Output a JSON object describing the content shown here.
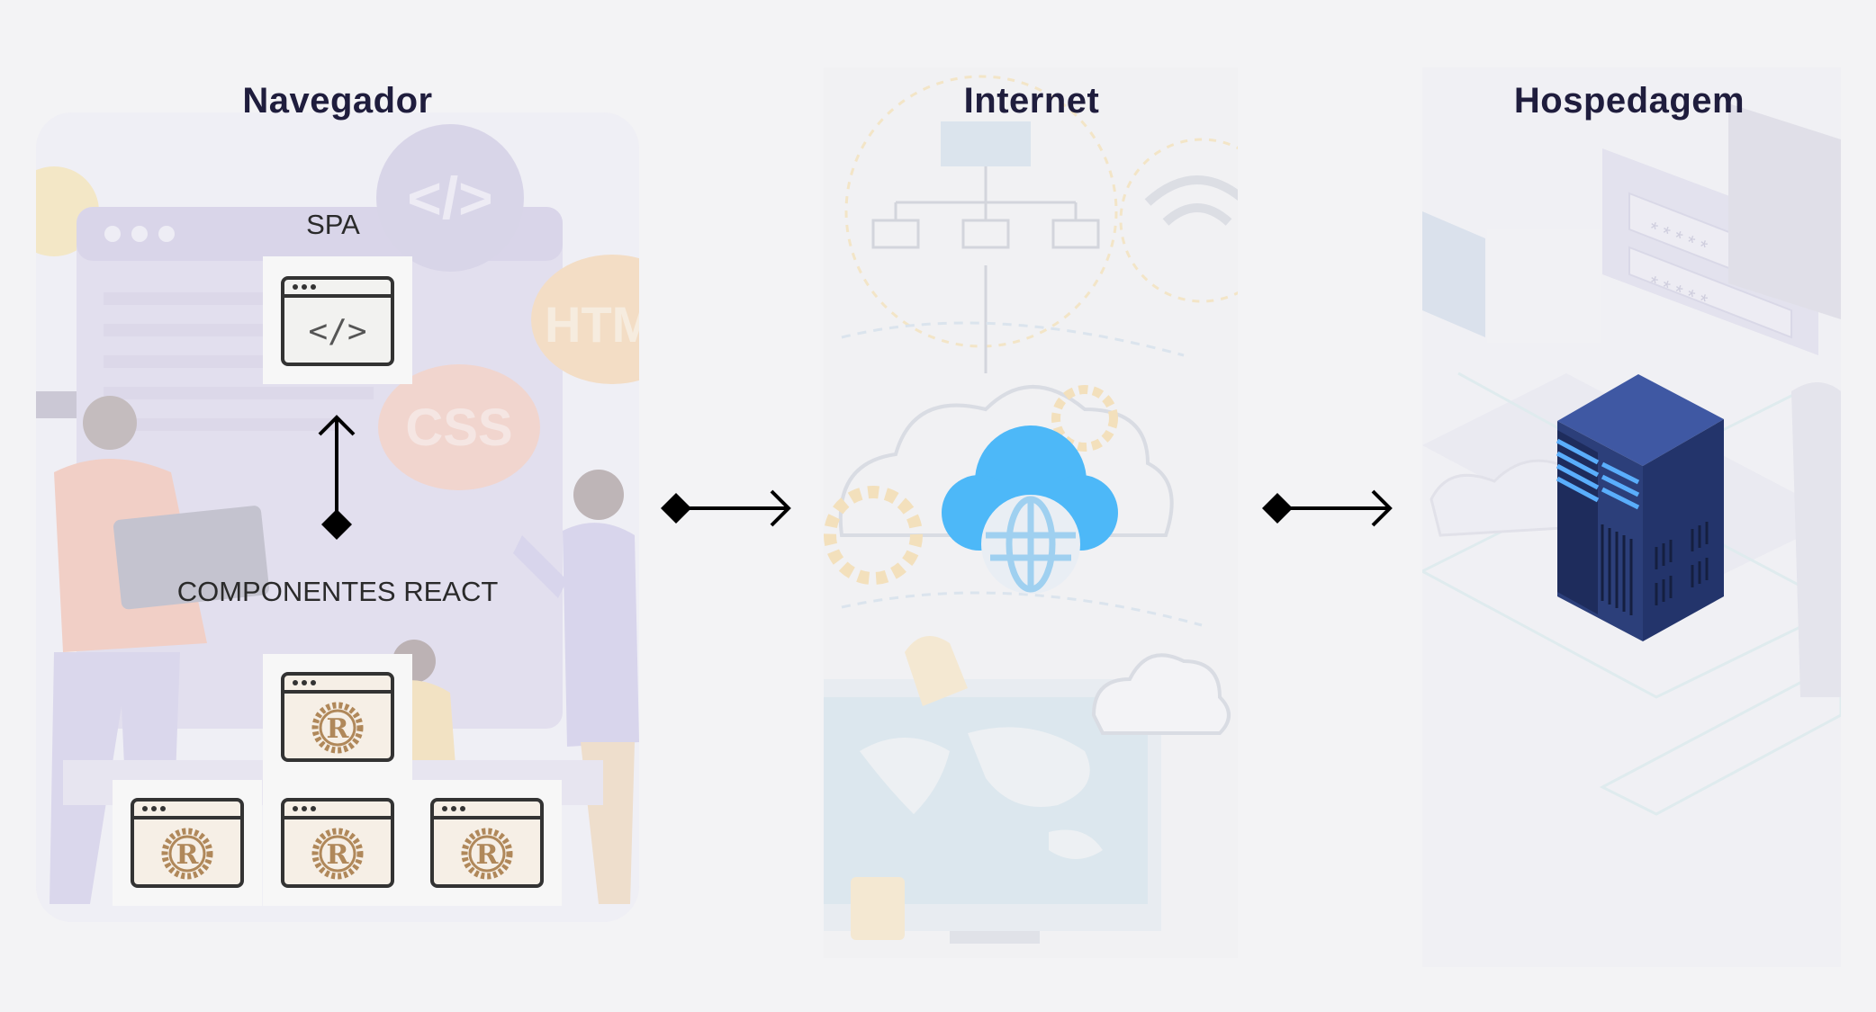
{
  "columns": {
    "browser": {
      "title": "Navegador"
    },
    "internet": {
      "title": "Internet"
    },
    "hosting": {
      "title": "Hospedagem"
    }
  },
  "browser": {
    "spa_label": "SPA",
    "components_label": "COMPONENTES REACT",
    "background_badges": [
      "</>",
      "HTML",
      "CSS"
    ]
  },
  "icons": {
    "spa": "code-window-icon",
    "component": "rust-window-icon",
    "internet": "cloud-globe-icon",
    "hosting": "server-icon"
  },
  "colors": {
    "title": "#1f1d3d",
    "cloud": "#4db8f8",
    "server": "#2c3f7a",
    "rust_logo": "#b0885a",
    "line": "#000000"
  }
}
